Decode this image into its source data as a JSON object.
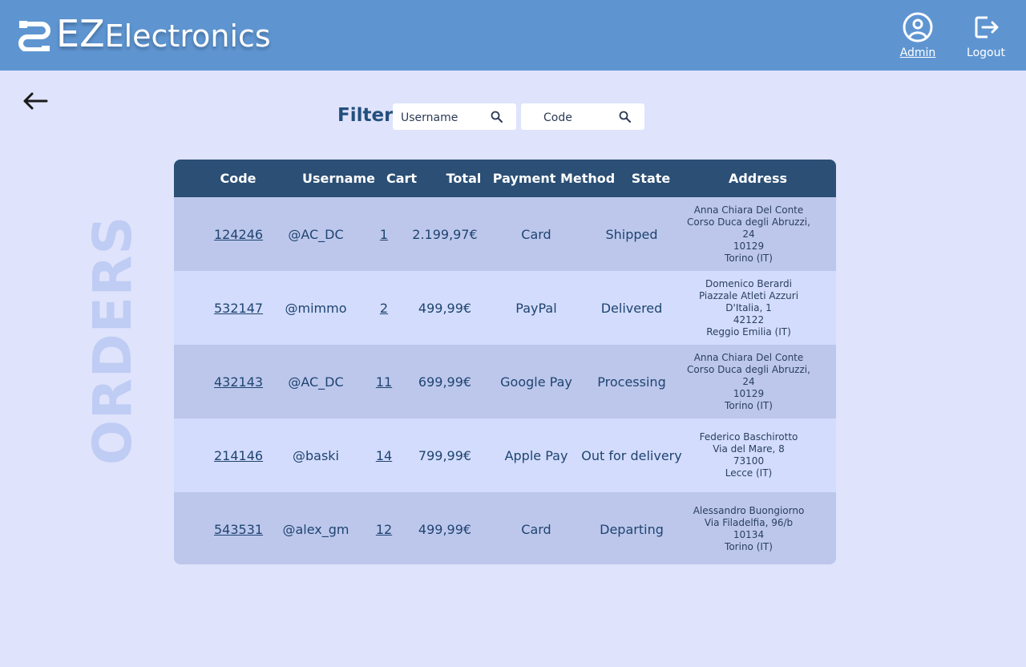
{
  "brand": {
    "ez": "EZ",
    "rest": "Electronics"
  },
  "nav": {
    "admin_label": "Admin",
    "logout_label": "Logout"
  },
  "filter": {
    "label": "Filter",
    "username_placeholder": "Username",
    "code_placeholder": "Code"
  },
  "watermark": "ORDERS",
  "table": {
    "headers": [
      "Code",
      "Username",
      "Cart",
      "Total",
      "Payment Method",
      "State",
      "Address"
    ],
    "rows": [
      {
        "code": "124246",
        "username": "@AC_DC",
        "cart": "1",
        "total": "2.199,97€",
        "payment": "Card",
        "state": "Shipped",
        "address": [
          "Anna Chiara Del Conte",
          "Corso Duca degli Abruzzi, 24",
          "10129",
          "Torino (IT)"
        ]
      },
      {
        "code": "532147",
        "username": "@mimmo",
        "cart": "2",
        "total": "499,99€",
        "payment": "PayPal",
        "state": "Delivered",
        "address": [
          "Domenico Berardi",
          "Piazzale Atleti Azzuri D'Italia, 1",
          "42122",
          "Reggio Emilia (IT)"
        ]
      },
      {
        "code": "432143",
        "username": "@AC_DC",
        "cart": "11",
        "total": "699,99€",
        "payment": "Google Pay",
        "state": "Processing",
        "address": [
          "Anna Chiara Del Conte",
          "Corso Duca degli Abruzzi, 24",
          "10129",
          "Torino (IT)"
        ]
      },
      {
        "code": "214146",
        "username": "@baski",
        "cart": "14",
        "total": "799,99€",
        "payment": "Apple Pay",
        "state": "Out for delivery",
        "address": [
          "Federico Baschirotto",
          "Via del Mare, 8",
          "73100",
          "Lecce (IT)"
        ]
      },
      {
        "code": "543531",
        "username": "@alex_gm",
        "cart": "12",
        "total": "499,99€",
        "payment": "Card",
        "state": "Departing",
        "address": [
          "Alessandro Buongiorno",
          "Via Filadelfia, 96/b",
          "10134",
          "Torino (IT)"
        ]
      }
    ]
  },
  "colors": {
    "topbar": "#5e95d1",
    "background": "#dfe3fb",
    "header": "#2b4f75",
    "row_odd": "#bdc7ec",
    "row_even": "#d3dcfc",
    "text": "#1f4470"
  },
  "icons": {
    "logo": "ez-logo-icon",
    "admin": "user-circle-icon",
    "logout": "logout-icon",
    "back": "arrow-left-icon",
    "search": "search-icon"
  }
}
